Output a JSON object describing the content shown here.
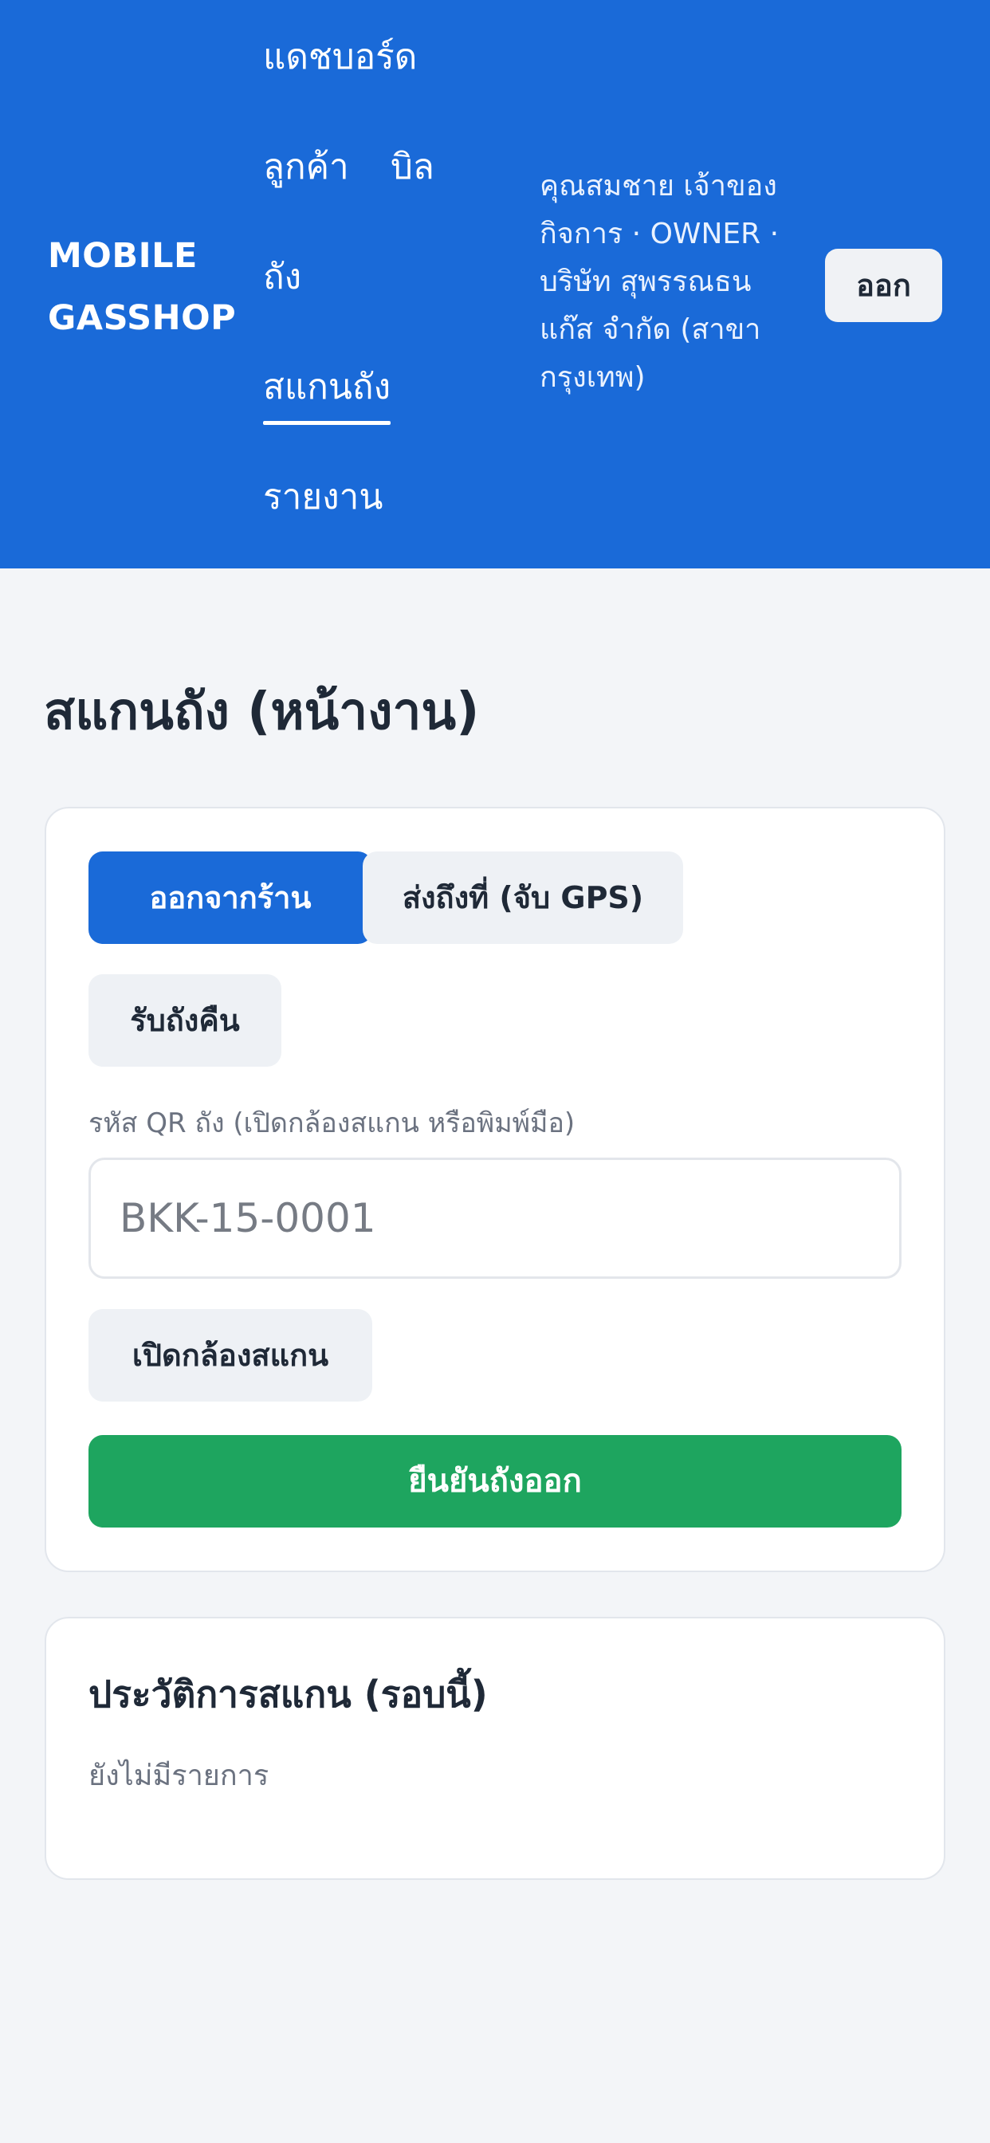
{
  "header": {
    "brand_line1": "MOBILE",
    "brand_line2": "GASSHOP",
    "nav": {
      "dashboard": "แดชบอร์ด",
      "customers": "ลูกค้า",
      "bills": "บิล",
      "tanks": "ถัง",
      "scan_tanks": "สแกนถัง",
      "reports": "รายงาน"
    },
    "active_nav": "scan_tanks",
    "user_info": "คุณสมชาย เจ้าของกิจการ · OWNER · บริษัท สุพรรณธน แก๊ส จำกัด (สาขากรุงเทพ)",
    "logout_label": "ออก"
  },
  "page": {
    "title": "สแกนถัง (หน้างาน)"
  },
  "scan": {
    "modes": {
      "leave_shop": "ออกจากร้าน",
      "deliver_gps": "ส่งถึงที่ (จับ GPS)",
      "receive_return": "รับถังคืน"
    },
    "selected_mode": "leave_shop",
    "qr_label": "รหัส QR ถัง (เปิดกล้องสแกน หรือพิมพ์มือ)",
    "qr_placeholder": "BKK-15-0001",
    "qr_value": "",
    "camera_button": "เปิดกล้องสแกน",
    "confirm_button": "ยืนยันถังออก"
  },
  "history": {
    "title": "ประวัติการสแกน (รอบนี้)",
    "empty_text": "ยังไม่มีรายการ"
  },
  "colors": {
    "header_bg": "#1a6ad8",
    "primary": "#1a6ad8",
    "confirm": "#1ea55f",
    "page_bg": "#f3f5f8"
  }
}
